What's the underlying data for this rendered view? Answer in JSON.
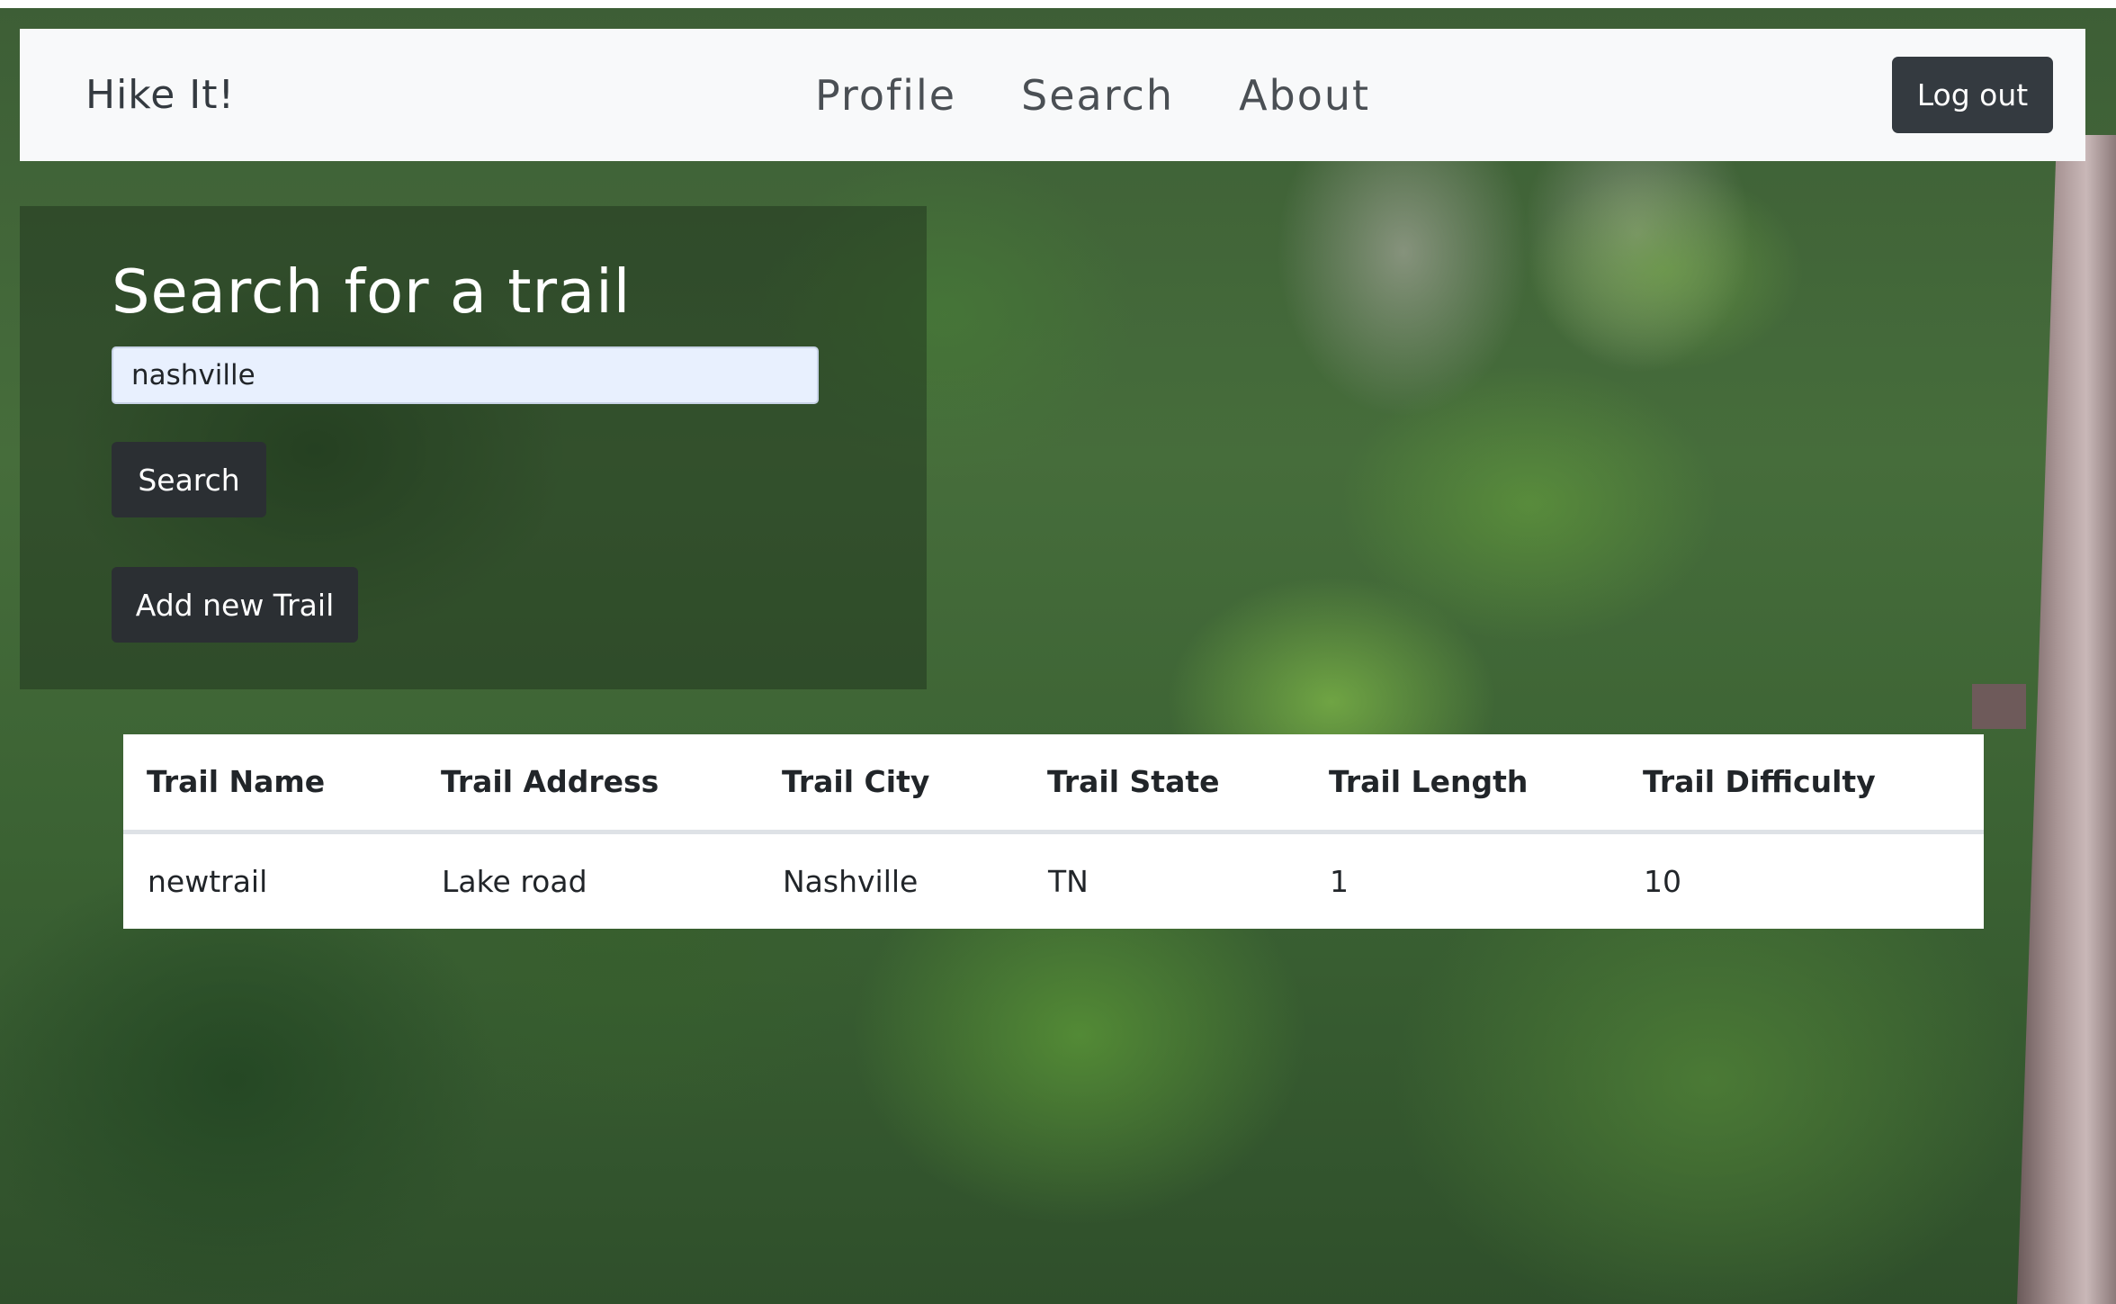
{
  "navbar": {
    "brand": "Hike It!",
    "links": [
      {
        "label": "Profile"
      },
      {
        "label": "Search"
      },
      {
        "label": "About"
      }
    ],
    "logout_label": "Log out"
  },
  "search": {
    "title": "Search for a trail",
    "input_value": "nashville",
    "search_button_label": "Search",
    "add_button_label": "Add new Trail"
  },
  "results": {
    "headers": [
      "Trail Name",
      "Trail Address",
      "Trail City",
      "Trail State",
      "Trail Length",
      "Trail Difficulty"
    ],
    "rows": [
      [
        "newtrail",
        "Lake road",
        "Nashville",
        "TN",
        "1",
        "10"
      ]
    ]
  },
  "colors": {
    "navbar_bg": "#f8f9fa",
    "dark_button": "#343a40",
    "input_bg": "#e8f0fe"
  }
}
